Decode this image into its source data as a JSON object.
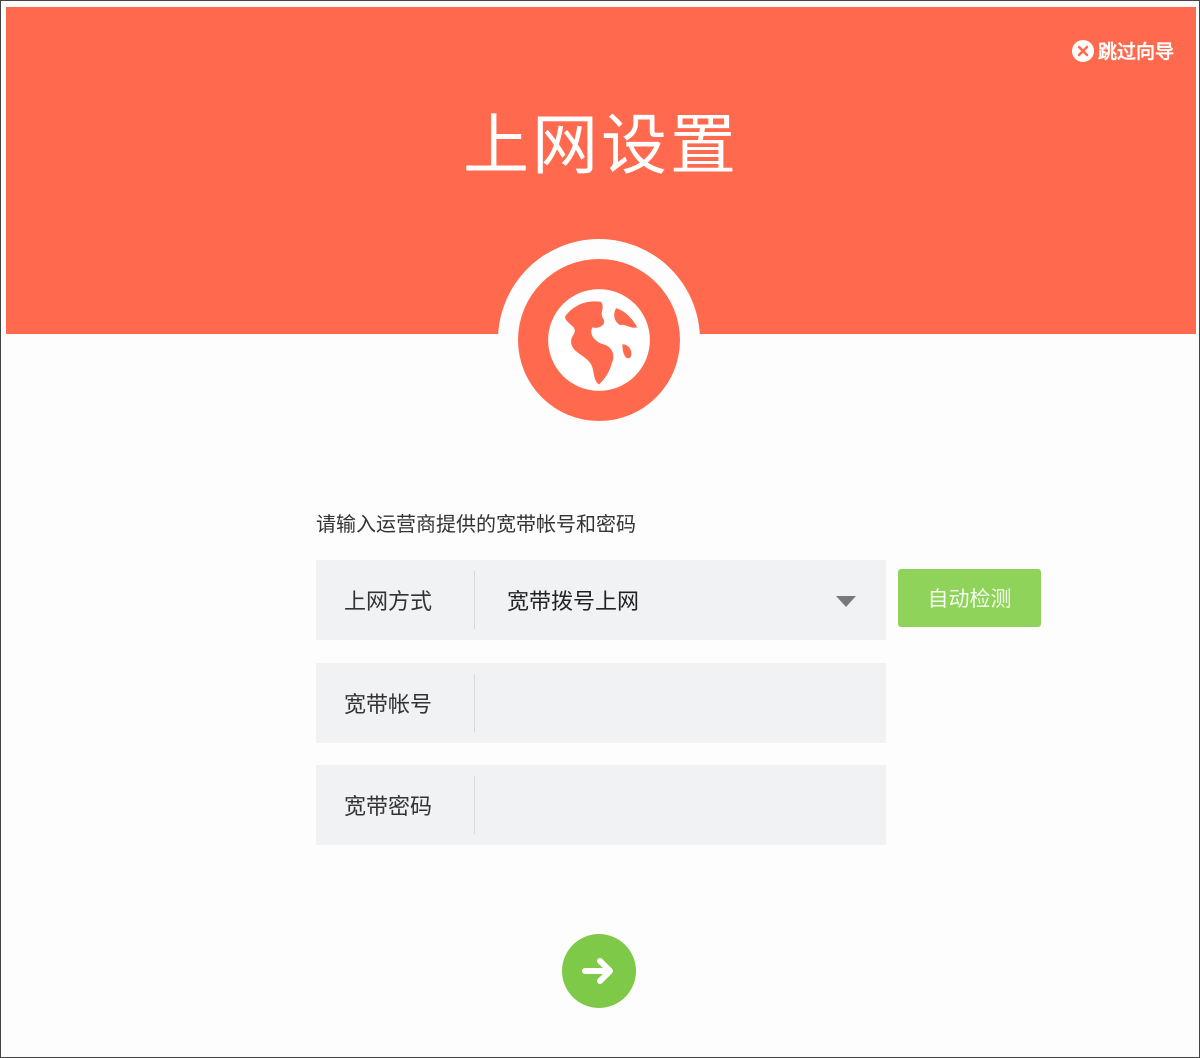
{
  "colors": {
    "header_bg": "#ff6a4e",
    "accent_green": "#8fd35a",
    "next_green": "#7fc948"
  },
  "header": {
    "skip_label": "跳过向导",
    "skip_icon": "close-circle-icon",
    "title": "上网设置",
    "badge_icon": "globe-icon"
  },
  "form": {
    "instruction": "请输入运营商提供的宽带帐号和密码",
    "connection_type": {
      "label": "上网方式",
      "value": "宽带拨号上网",
      "icon": "triangle-down-icon"
    },
    "auto_detect_label": "自动检测",
    "account": {
      "label": "宽带帐号",
      "value": "",
      "placeholder": ""
    },
    "password": {
      "label": "宽带密码",
      "value": "",
      "placeholder": ""
    }
  },
  "next_button": {
    "icon": "arrow-right-icon"
  }
}
